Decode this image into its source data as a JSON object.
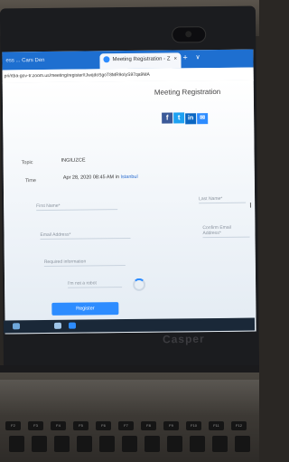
{
  "browser": {
    "tab1_label": "ess ... Cars Den",
    "tab2_label": "Meeting Registration - Z",
    "tab_close": "×",
    "tab_new": "+",
    "tab_menu": "∨",
    "address": "pri/rtba-gov-tr.zoom.us/meeting/register/tJwqdoSgoT8MR9oIyS97qa9MA"
  },
  "page": {
    "title": "Meeting Registration",
    "share": {
      "facebook": "f",
      "twitter": "t",
      "linkedin": "in",
      "email": "✉"
    },
    "topic_label": "Topic",
    "topic_value": "INGILIZCE",
    "time_label": "Time",
    "time_value": "Apr 28, 2020 08:45 AM in ",
    "time_tz": "Istanbul",
    "fields": {
      "first_name": "First Name*",
      "last_name": "Last Name*",
      "email": "Email Address*",
      "confirm_email": "Confirm Email Address*",
      "extra": "Required information",
      "captcha": "I'm not a robot"
    },
    "register_label": "Register"
  },
  "laptop": {
    "brand": "Casper"
  },
  "keyboard": {
    "fkeys": [
      "F2",
      "F3",
      "F4",
      "F5",
      "F6",
      "F7",
      "F8",
      "F9",
      "F10",
      "F11",
      "F12"
    ]
  },
  "colors": {
    "zoom_blue": "#2d8cff",
    "browser_blue": "#1e6fd0"
  }
}
